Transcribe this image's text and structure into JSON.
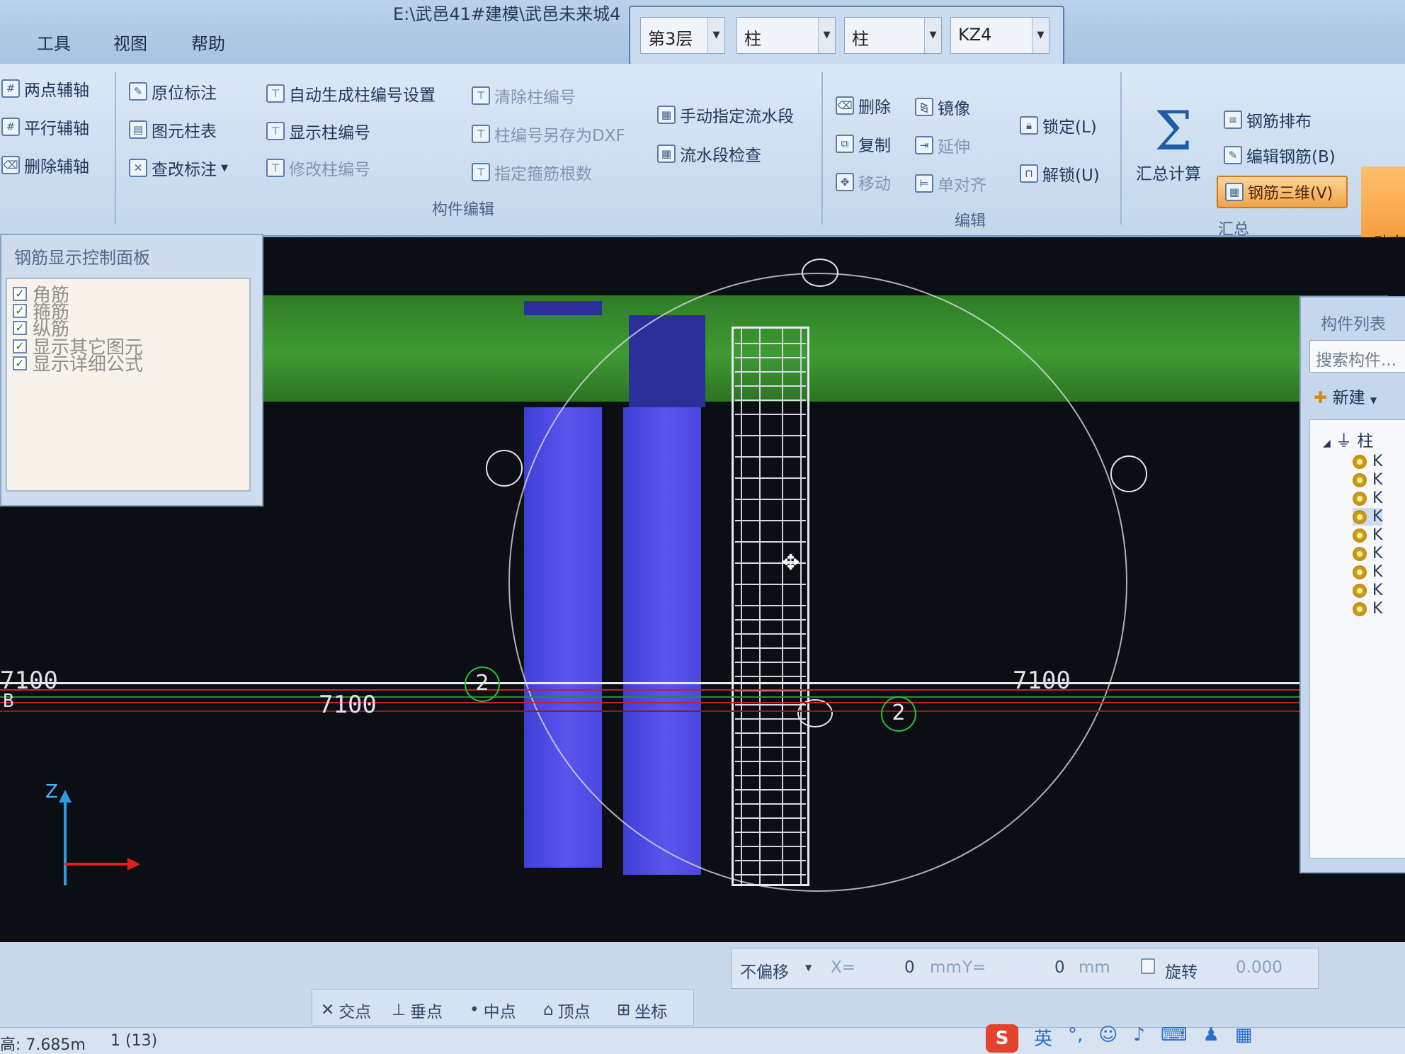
{
  "window": {
    "title_path": "E:\\武邑41#建模\\武邑未来城4"
  },
  "menus": [
    "工具",
    "视图",
    "帮助"
  ],
  "selectors": {
    "floor": "第3层",
    "category": "柱",
    "type": "柱",
    "component": "KZ4"
  },
  "ribbon": {
    "axis": [
      "两点辅轴",
      "平行辅轴",
      "删除辅轴"
    ],
    "mark": [
      "原位标注",
      "图元柱表",
      "查改标注"
    ],
    "column_no": [
      "自动生成柱编号设置",
      "显示柱编号",
      "修改柱编号"
    ],
    "column_no2": [
      "清除柱编号",
      "柱编号另存为DXF",
      "指定箍筋根数"
    ],
    "flow": [
      "手动指定流水段",
      "流水段检查"
    ],
    "component_edit_label": "构件编辑",
    "edit": [
      "删除",
      "镜像",
      "复制",
      "延伸",
      "移动",
      "单对齐"
    ],
    "edit_label": "编辑",
    "lock": "锁定(L)",
    "unlock": "解锁(U)",
    "sum_calc": "汇总计算",
    "rebar": [
      "钢筋排布",
      "编辑钢筋(B)",
      "钢筋三维(V)"
    ],
    "summary_label": "汇总",
    "dynamic": "动态"
  },
  "rebar_panel": {
    "title": "钢筋显示控制面板",
    "options": [
      "角筋",
      "箍筋",
      "纵筋",
      "显示其它图元",
      "显示详细公式"
    ]
  },
  "component_list": {
    "title": "构件列表",
    "search_placeholder": "搜索构件...",
    "new_label": "新建",
    "root": "柱",
    "items": [
      "K",
      "K",
      "K",
      "K",
      "K",
      "K",
      "K",
      "K",
      "K"
    ]
  },
  "viewport": {
    "dims": [
      "7100",
      "7100",
      "7100",
      "7100"
    ],
    "axis_b": "B",
    "axis_tags": [
      "2",
      "2"
    ],
    "z_label": "Z"
  },
  "offset_bar": {
    "mode": "不偏移",
    "x_label": "X=",
    "x_value": "0",
    "unit1": "mm",
    "y_label": "Y=",
    "y_value": "0",
    "unit2": "mm",
    "rotate": "旋转",
    "angle": "0.000"
  },
  "snaps": [
    "交点",
    "垂点",
    "中点",
    "顶点",
    "坐标"
  ],
  "status": {
    "elevation": "高: 7.685m",
    "selection": "1 (13)"
  },
  "ime": {
    "logo": "S",
    "lang": "英"
  }
}
